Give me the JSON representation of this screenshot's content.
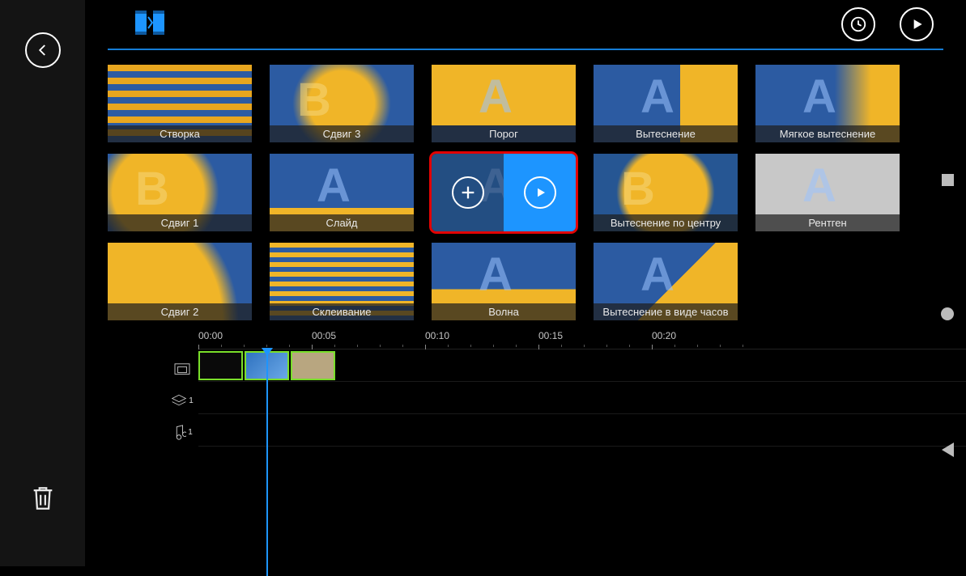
{
  "toolbar": {
    "back": "back",
    "transitions_tab": "transitions",
    "time": "time",
    "play": "play"
  },
  "transitions": [
    {
      "label": "Створка",
      "cls": "th-stripes",
      "letters": ""
    },
    {
      "label": "Сдвиг 3",
      "cls": "th-burst",
      "letters": "B"
    },
    {
      "label": "Порог",
      "cls": "th-porog",
      "letters": "A"
    },
    {
      "label": "Вытеснение",
      "cls": "th-vyt",
      "letters": "A"
    },
    {
      "label": "Мягкое вытеснение",
      "cls": "th-soft",
      "letters": "A"
    },
    {
      "label": "Сдвиг 1",
      "cls": "th-shift1",
      "letters": "B"
    },
    {
      "label": "Слайд",
      "cls": "th-slide",
      "letters": "A"
    },
    {
      "label": "",
      "cls": "th-blue",
      "letters": "A",
      "selected": true
    },
    {
      "label": "Вытеснение по центру",
      "cls": "th-center",
      "letters": "B"
    },
    {
      "label": "Рентген",
      "cls": "th-xray",
      "letters": "A"
    },
    {
      "label": "Сдвиг 2",
      "cls": "th-shift2",
      "letters": ""
    },
    {
      "label": "Склеивание",
      "cls": "th-glue",
      "letters": ""
    },
    {
      "label": "Волна",
      "cls": "th-wave",
      "letters": "A"
    },
    {
      "label": "Вытеснение в виде часов",
      "cls": "th-clock",
      "letters": "A"
    }
  ],
  "timeline": {
    "ticks": [
      "00:00",
      "00:05",
      "00:10",
      "00:15",
      "00:20"
    ],
    "tracks": {
      "video": "video",
      "layer": "1",
      "audio": "1"
    }
  },
  "sidebar": {
    "trash": "delete"
  }
}
